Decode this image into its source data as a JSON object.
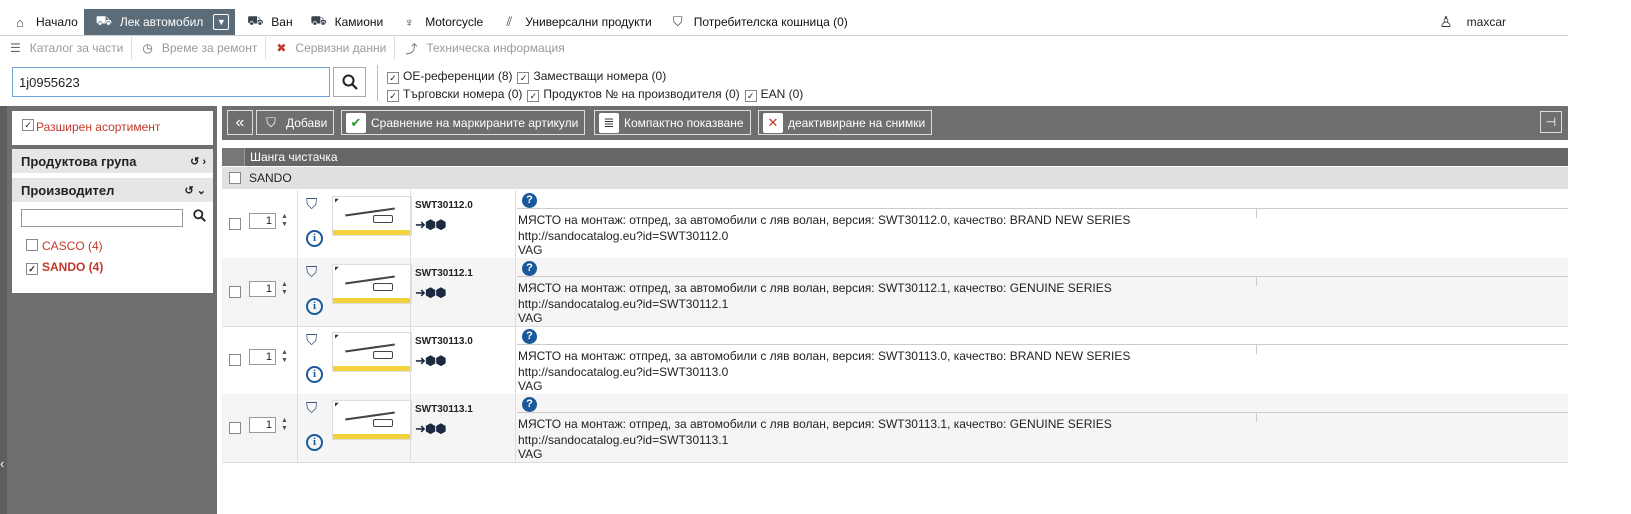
{
  "topnav": {
    "items": [
      {
        "label": "Начало",
        "icon": "home-icon"
      },
      {
        "label": "Лек автомобил",
        "icon": "car-icon",
        "active": true
      },
      {
        "label": "Ван",
        "icon": "van-icon"
      },
      {
        "label": "Камиони",
        "icon": "truck-icon"
      },
      {
        "label": "Motorcycle",
        "icon": "motorcycle-icon"
      },
      {
        "label": "Универсални продукти",
        "icon": "universal-products-icon"
      },
      {
        "label": "Потребителска кошница (0)",
        "icon": "cart-icon"
      }
    ],
    "user": "maxcar"
  },
  "subnav": {
    "items": [
      {
        "label": "Каталог за части",
        "icon": "catalog-icon"
      },
      {
        "label": "Време за ремонт",
        "icon": "clock-icon"
      },
      {
        "label": "Сервизни данни",
        "icon": "tools-icon"
      },
      {
        "label": "Техническа информация",
        "icon": "chart-icon"
      }
    ]
  },
  "search": {
    "value": "1j0955623"
  },
  "filters": {
    "oe": "ОЕ-референции (8)",
    "replace": "Заместващи номера (0)",
    "trade": "Търговски номера (0)",
    "producer": "Продуктов № на производителя (0)",
    "ean": "EAN (0)"
  },
  "sidebar": {
    "extended": "Разширен асортимент",
    "product_group": "Продуктова група",
    "manufacturer": "Производител",
    "manufacturers": [
      {
        "label": "CASCO  (4)",
        "checked": false
      },
      {
        "label": "SANDO  (4)",
        "checked": true
      }
    ]
  },
  "toolbar": {
    "add": "Добави",
    "compare": "Сравнение на маркираните артикули",
    "compact": "Компактно показване",
    "images": "деактивиране на снимки"
  },
  "list": {
    "group_title": "Шанга чистачка",
    "manufacturer": "SANDO",
    "articles": [
      {
        "number": "SWT30112.0",
        "qty": "1",
        "description": "МЯСТО на монтаж: отпред, за автомобили с ляв волан, версия: SWT30112.0, качество: BRAND NEW SERIES",
        "url": "http://sandocatalog.eu?id=SWT30112.0",
        "brand": "VAG"
      },
      {
        "number": "SWT30112.1",
        "qty": "1",
        "description": "МЯСТО на монтаж: отпред, за автомобили с ляв волан, версия: SWT30112.1, качество: GENUINE SERIES",
        "url": "http://sandocatalog.eu?id=SWT30112.1",
        "brand": "VAG"
      },
      {
        "number": "SWT30113.0",
        "qty": "1",
        "description": "МЯСТО на монтаж: отпред, за автомобили с ляв волан, версия: SWT30113.0, качество: BRAND NEW SERIES",
        "url": "http://sandocatalog.eu?id=SWT30113.0",
        "brand": "VAG"
      },
      {
        "number": "SWT30113.1",
        "qty": "1",
        "description": "МЯСТО на монтаж: отпред, за автомобили с ляв волан, версия: SWT30113.1, качество: GENUINE SERIES",
        "url": "http://sandocatalog.eu?id=SWT30113.1",
        "brand": "VAG"
      }
    ]
  }
}
